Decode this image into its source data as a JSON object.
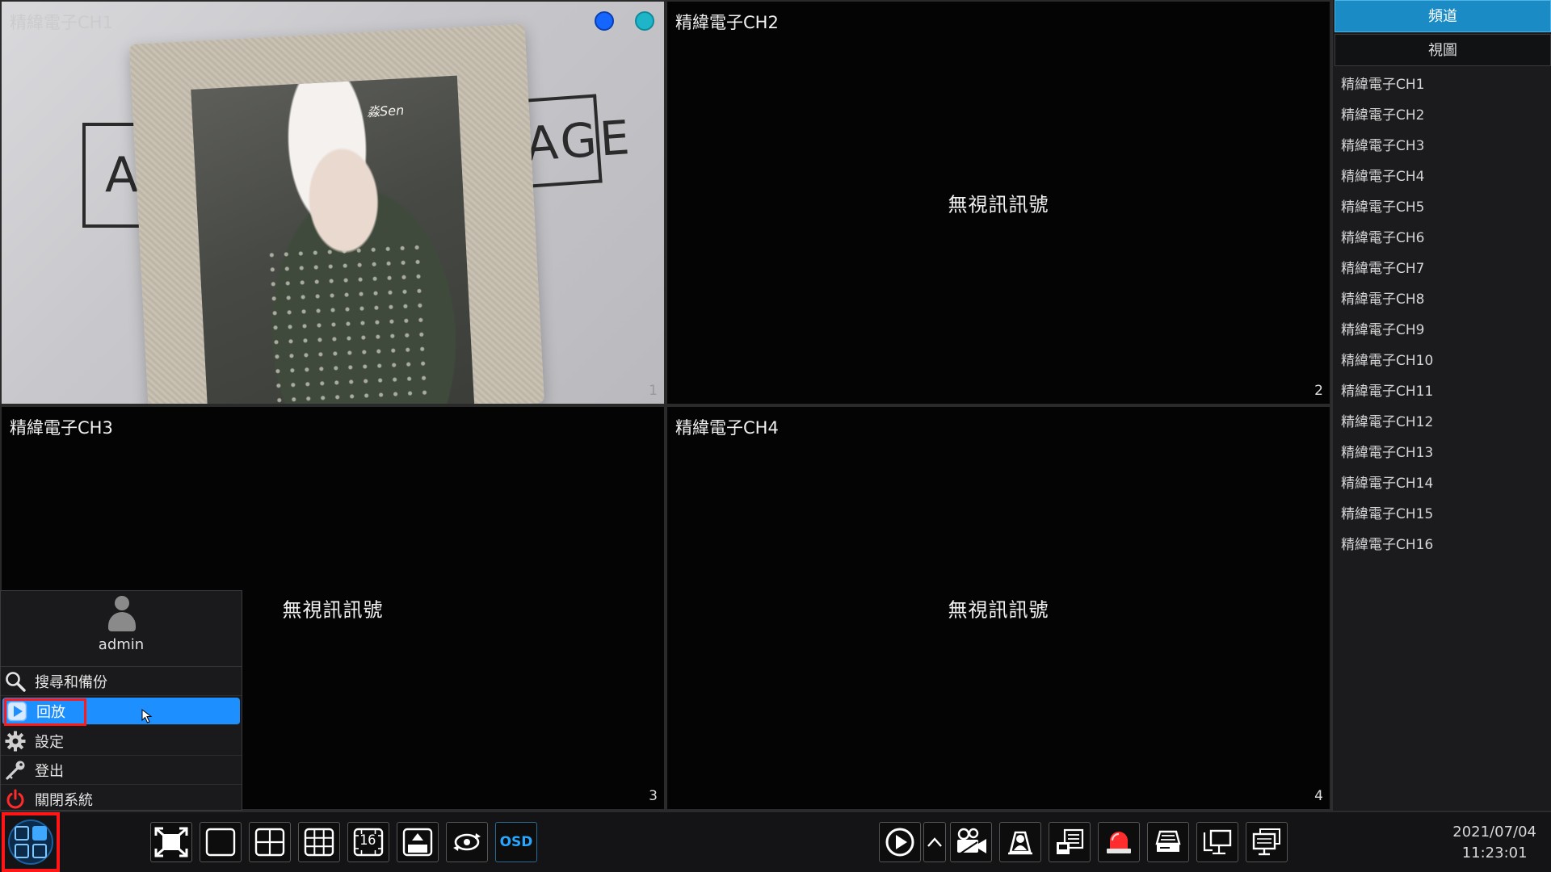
{
  "cameras": [
    {
      "title": "精緯電子CH1",
      "number": "1",
      "signal": true
    },
    {
      "title": "精緯電子CH2",
      "number": "2",
      "signal": false,
      "status": "無視訊訊號"
    },
    {
      "title": "精緯電子CH3",
      "number": "3",
      "signal": false,
      "status": "無視訊訊號"
    },
    {
      "title": "精緯電子CH4",
      "number": "4",
      "signal": false,
      "status": "無視訊訊號"
    }
  ],
  "ch1_photo_signature": "淼Sen",
  "ch1_wall_text_left": "A",
  "ch1_wall_text_right": "GAGE",
  "side_panel": {
    "tab_channel": "頻道",
    "tab_view": "視圖",
    "channels": [
      "精緯電子CH1",
      "精緯電子CH2",
      "精緯電子CH3",
      "精緯電子CH4",
      "精緯電子CH5",
      "精緯電子CH6",
      "精緯電子CH7",
      "精緯電子CH8",
      "精緯電子CH9",
      "精緯電子CH10",
      "精緯電子CH11",
      "精緯電子CH12",
      "精緯電子CH13",
      "精緯電子CH14",
      "精緯電子CH15",
      "精緯電子CH16"
    ]
  },
  "start_menu": {
    "user": "admin",
    "items": {
      "search_backup": "搜尋和備份",
      "playback": "回放",
      "settings": "設定",
      "logout": "登出",
      "shutdown": "關閉系統"
    }
  },
  "toolbar": {
    "layout16_label": "16",
    "osd_label": "OSD"
  },
  "clock": {
    "date": "2021/07/04",
    "time": "11:23:01"
  },
  "colors": {
    "accent": "#1a8bc4",
    "selected": "#1e8fff",
    "highlight_outline": "#ff1a1a",
    "osd_text": "#27a7ff"
  }
}
